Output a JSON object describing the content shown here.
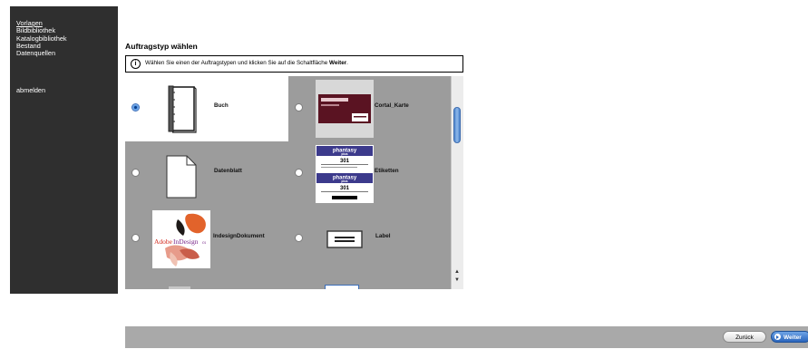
{
  "sidebar": {
    "items": [
      {
        "label": "Vorlagen",
        "active": true
      },
      {
        "label": "Bildbibliothek",
        "active": false
      },
      {
        "label": "Katalogbibliothek",
        "active": false
      },
      {
        "label": "Bestand",
        "active": false
      },
      {
        "label": "Datenquellen",
        "active": false
      }
    ],
    "logout_label": "abmelden"
  },
  "main": {
    "title": "Auftragstyp wählen",
    "info": {
      "icon": "info-icon",
      "text_before": "Wählen Sie einen der Auftragstypen und klicken Sie auf die Schaltfläche ",
      "text_bold": "Weiter",
      "text_after": "."
    },
    "job_types": [
      {
        "label": "Buch",
        "thumbnail": "book-binder-icon",
        "selected": true
      },
      {
        "label": "Cortal_Karte",
        "thumbnail": "business-card-preview",
        "selected": false
      },
      {
        "label": "Datenblatt",
        "thumbnail": "document-page-icon",
        "selected": false
      },
      {
        "label": "Etiketten",
        "thumbnail": "label-sheet-preview",
        "selected": false
      },
      {
        "label": "IndesignDokument",
        "thumbnail": "adobe-indesign-cs-logo",
        "selected": false
      },
      {
        "label": "Label",
        "thumbnail": "label-icon",
        "selected": false
      }
    ],
    "thumbnail_text": {
      "etiketten_top": "phantasy",
      "etiketten_sub": "plus",
      "etiketten_num": "301",
      "indesign_a": "Adobe",
      "indesign_b": "InDesign",
      "indesign_c": "cs"
    }
  },
  "footer": {
    "back_label": "Zurück",
    "next_label": "Weiter"
  },
  "colors": {
    "sidebar_bg": "#2f2f2f",
    "grid_bg": "#9c9c9c",
    "selected_bg": "#ffffff",
    "accent": "#2b66bd"
  }
}
